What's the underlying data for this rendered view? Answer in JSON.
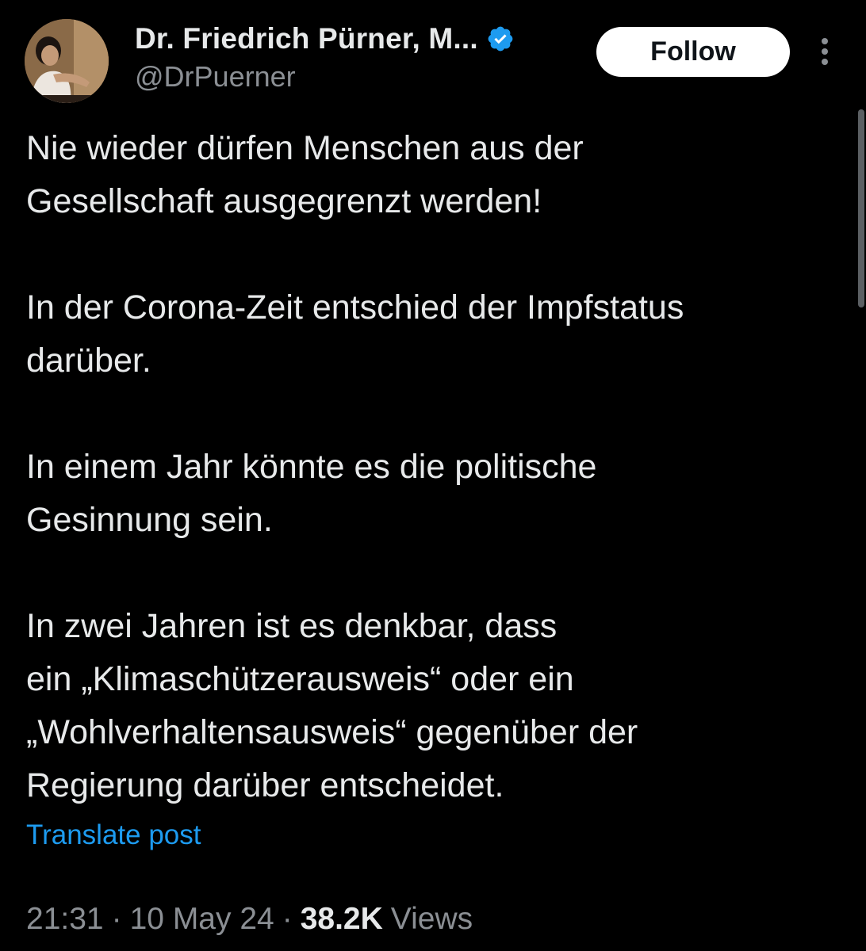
{
  "author": {
    "display_name": "Dr. Friedrich Pürner, M...",
    "handle": "@DrPuerner",
    "verified": true,
    "verified_color": "#1d9bf0"
  },
  "actions": {
    "follow_label": "Follow"
  },
  "post": {
    "paragraphs": [
      "Nie wieder dürfen Menschen aus der\nGesellschaft ausgegrenzt werden!",
      "In der Corona-Zeit entschied der Impfstatus\ndarüber.",
      "In einem Jahr könnte es die politische\nGesinnung sein.",
      "In zwei Jahren ist es denkbar, dass\nein „Klimaschützerausweis“ oder ein\n„Wohlverhaltensausweis“ gegenüber der\nRegierung darüber entscheidet."
    ],
    "translate_label": "Translate post"
  },
  "meta": {
    "time": "21:31",
    "separator": "·",
    "date": "10 May 24",
    "views_count": "38.2K",
    "views_label": "Views"
  },
  "colors": {
    "background": "#000000",
    "text": "#e7e9ea",
    "secondary_text": "#8b8f94",
    "link": "#1d9bf0",
    "follow_bg": "#ffffff"
  },
  "icons": {
    "verified": "verified-badge-icon",
    "more": "more-vertical-icon"
  }
}
